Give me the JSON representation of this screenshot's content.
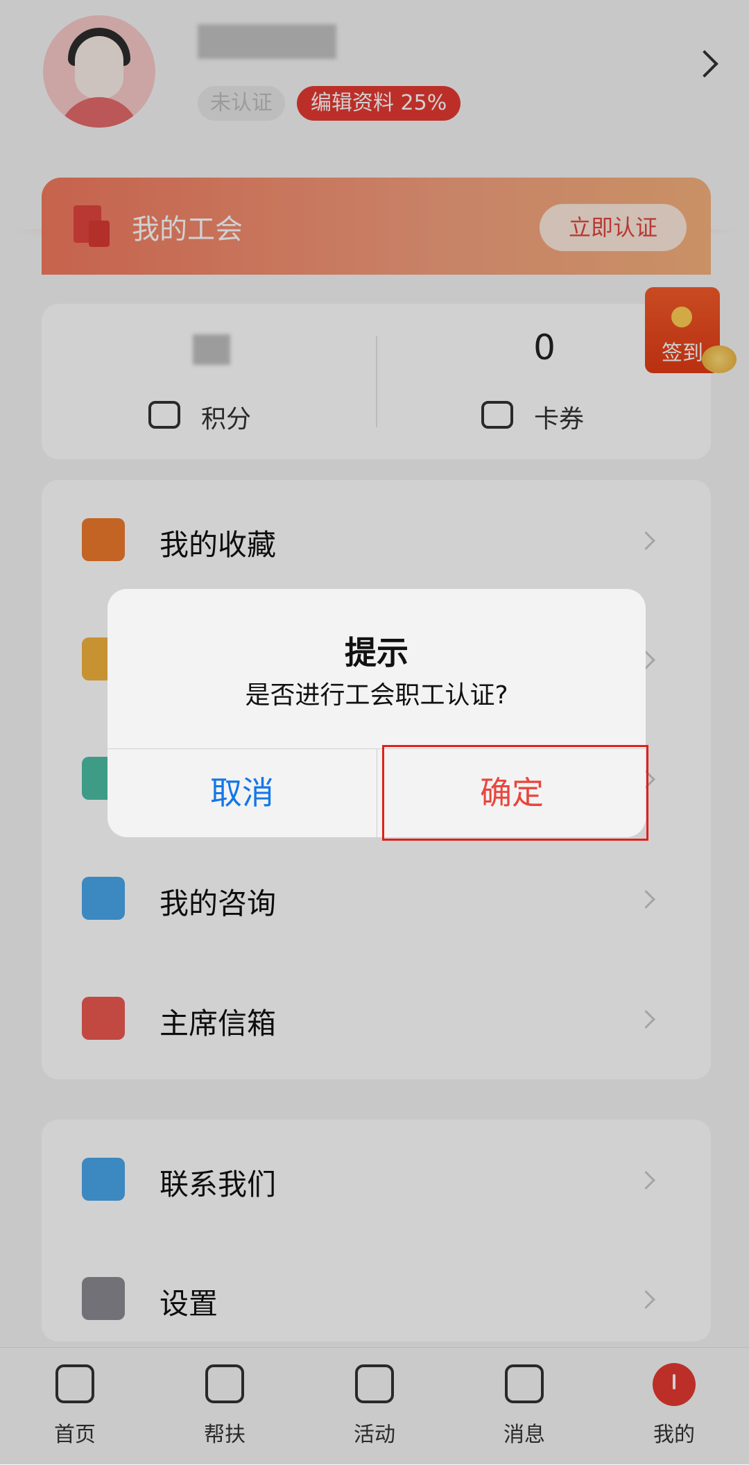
{
  "profile": {
    "badge_unverified": "未认证",
    "badge_edit": "编辑资料 25%"
  },
  "union": {
    "title": "我的工会",
    "verify_button": "立即认证"
  },
  "stats": {
    "points_label": "积分",
    "coupon_value": "0",
    "coupon_label": "卡券"
  },
  "signin": {
    "label": "签到"
  },
  "menu": {
    "items": [
      {
        "label": "我的收藏",
        "icon": "heart-plus-icon",
        "color": "#ee7a2e"
      },
      {
        "label": "",
        "icon": "balloon-icon",
        "color": "#f2b33d"
      },
      {
        "label": "",
        "icon": "note-icon",
        "color": "#4cbfa4"
      },
      {
        "label": "我的咨询",
        "icon": "chat-icon",
        "color": "#4aa6ec"
      },
      {
        "label": "主席信箱",
        "icon": "mailbox-icon",
        "color": "#ec5a51"
      }
    ],
    "items2": [
      {
        "label": "联系我们",
        "icon": "robot-icon",
        "color": "#4aa6ec"
      },
      {
        "label": "设置",
        "icon": "gear-icon",
        "color": "#8a8a92"
      }
    ]
  },
  "nav": {
    "items": [
      {
        "label": "首页",
        "icon": "home-icon"
      },
      {
        "label": "帮扶",
        "icon": "handshake-icon"
      },
      {
        "label": "活动",
        "icon": "gift-icon"
      },
      {
        "label": "消息",
        "icon": "message-icon"
      },
      {
        "label": "我的",
        "icon": "profile-icon",
        "active": true
      }
    ]
  },
  "dialog": {
    "title": "提示",
    "message": "是否进行工会职工认证?",
    "cancel": "取消",
    "confirm": "确定"
  },
  "colors": {
    "accent_red": "#e63a33",
    "link_blue": "#1477e6"
  }
}
